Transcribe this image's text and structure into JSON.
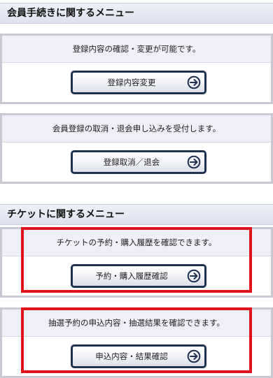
{
  "member_menu": {
    "title": "会員手続きに関するメニュー",
    "cards": [
      {
        "description": "登録内容の確認・変更が可能です。",
        "button_label": "登録内容変更"
      },
      {
        "description": "会員登録の取消・退会申し込みを受付します。",
        "button_label": "登録取消／退会"
      }
    ]
  },
  "ticket_menu": {
    "title": "チケットに関するメニュー",
    "cards": [
      {
        "description": "チケットの予約・購入履歴を確認できます。",
        "button_label": "予約・購入履歴確認"
      },
      {
        "description": "抽選予約の申込内容・抽選結果を確認できます。",
        "button_label": "申込内容・結果確認"
      }
    ]
  },
  "icons": {
    "button_arrow": "arrow-circle-right-icon"
  },
  "colors": {
    "highlight": "#e0121b",
    "button_border": "#1f3151",
    "card_border": "#c8c9d2"
  }
}
